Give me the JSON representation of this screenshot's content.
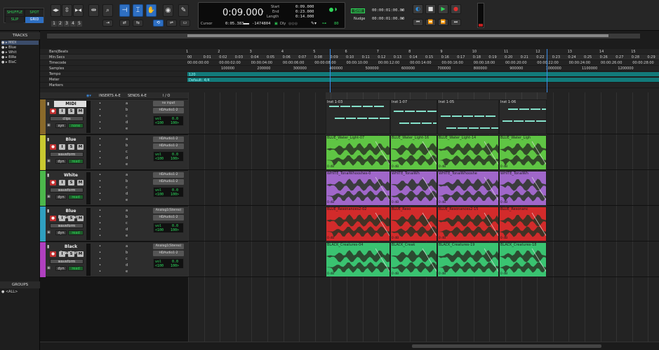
{
  "toolbar": {
    "modes": {
      "shuffle": "SHUFFLE",
      "spot": "SPOT",
      "slip": "SLIP",
      "grid": "GRID"
    },
    "zoom_presets": [
      "1",
      "2",
      "3",
      "4",
      "5"
    ],
    "main_counter": "0:09.000",
    "start_label": "Start",
    "end_label": "End",
    "length_label": "Length",
    "start": "0:09.000",
    "end": "0:23.000",
    "length": "0:14.000",
    "cursor_label": "Cursor",
    "cursor": "0:05.383",
    "sample": "-1474804",
    "dly_label": "Dly",
    "value80": "80",
    "grid_label": "Grid",
    "nudge_label": "Nudge",
    "grid_value": "00:00:01:00.00",
    "nudge_value": "00:00:01:00.00"
  },
  "left": {
    "tracks_header": "TRACKS",
    "track_list": [
      "MIDI",
      "Blue",
      "Whit",
      "BIRe",
      "BlaC"
    ],
    "groups_header": "GROUPS",
    "group_all": "<ALL>"
  },
  "rulers": {
    "rows": [
      "Bars|Beats",
      "Min:Secs",
      "Timecode",
      "Samples",
      "Tempo",
      "Meter",
      "Markers"
    ],
    "bar_ticks": [
      "1",
      "2",
      "3",
      "4",
      "5",
      "6",
      "7",
      "8",
      "9",
      "10",
      "11",
      "12",
      "13",
      "14",
      "15"
    ],
    "sec_ticks": [
      "00",
      "0:01",
      "0:02",
      "0:03",
      "0:04",
      "0:05",
      "0:06",
      "0:07",
      "0:08",
      "0:09",
      "0:10",
      "0:11",
      "0:12",
      "0:13",
      "0:14",
      "0:15",
      "0:16",
      "0:17",
      "0:18",
      "0:19",
      "0:20",
      "0:21",
      "0:22",
      "0:23",
      "0:24",
      "0:25",
      "0:26",
      "0:27",
      "0:28",
      "0:29"
    ],
    "timecode_ticks": [
      "00:00:00:00",
      "00:00:02:00",
      "00:00:04:00",
      "00:00:06:00",
      "00:00:08:00",
      "00:00:10:00",
      "00:00:12:00",
      "00:00:14:00",
      "00:00:16:00",
      "00:00:18:00",
      "00:00:20:00",
      "00:00:22:00",
      "00:00:24:00",
      "00:00:26:00",
      "00:00:28:00"
    ],
    "sample_ticks": [
      "100000",
      "200000",
      "300000",
      "400000",
      "500000",
      "600000",
      "700000",
      "800000",
      "900000",
      "1000000",
      "1100000",
      "1200000"
    ],
    "tempo": "120",
    "meter": "Default: 4/4"
  },
  "columns": {
    "inserts": "INSERTS A-E",
    "sends": "SENDS A-E",
    "io": "I / O"
  },
  "tracks": [
    {
      "name": "MIDI",
      "view": "clips",
      "mode": "none",
      "input": "no input",
      "output": "HDAudio1-2",
      "vol": "0.0",
      "pan_l": "<100",
      "pan_r": "100>",
      "inserts": [
        "•",
        "•",
        "•",
        "•",
        "•"
      ],
      "sends": [
        "a",
        "b",
        "c",
        "d",
        "e"
      ],
      "color": "#8a6a2a"
    },
    {
      "name": "Blue",
      "view": "waveform",
      "mode": "read",
      "input": "HDAudio1-2",
      "output": "HDAudio1-2",
      "vol": "0.0",
      "pan_l": "<100",
      "pan_r": "100>",
      "inserts": [
        "•",
        "•",
        "•",
        "•",
        "•"
      ],
      "sends": [
        "a",
        "b",
        "c",
        "d",
        "e"
      ],
      "color": "#c8c830"
    },
    {
      "name": "White",
      "view": "waveform",
      "mode": "read",
      "input": "HDAudio1-2",
      "output": "HDAudio1-2",
      "vol": "0.0",
      "pan_l": "<100",
      "pan_r": "100>",
      "inserts": [
        "•",
        "•",
        "•",
        "•",
        "•"
      ],
      "sends": [
        "a",
        "b",
        "c",
        "d",
        "e"
      ],
      "color": "#4cb84c"
    },
    {
      "name": "Blue Resonance",
      "view": "waveform",
      "mode": "read",
      "input": "Analog1(Stereo)",
      "output": "HDAudio1-2",
      "vol": "0.0",
      "pan_l": "<100",
      "pan_r": "100>",
      "inserts": [
        "•",
        "•",
        "•",
        "•",
        "•"
      ],
      "sends": [
        "a",
        "b",
        "c",
        "d",
        "e"
      ],
      "color": "#2fa0c0"
    },
    {
      "name": "Black Creatures",
      "view": "waveform",
      "mode": "read",
      "input": "Analog1(Stereo)",
      "output": "HDAudio1-2",
      "vol": "0.0",
      "pan_l": "<100",
      "pan_r": "100>",
      "inserts": [
        "•",
        "•",
        "•",
        "•",
        "•"
      ],
      "sends": [
        "a",
        "b",
        "c",
        "d",
        "e"
      ],
      "color": "#b040c0"
    }
  ],
  "clips": [
    {
      "color": "#1f1f1f",
      "items": [
        "Inst 1-03",
        "Inst 1-07",
        "Inst 1-05",
        "Inst 1-06"
      ]
    },
    {
      "color": "#57c23a",
      "items": [
        "BLUE_Water_Light-07",
        "BLUE_Water_Light-16",
        "BLUE_Water_Light-14",
        "BLUE_Water_Ligh"
      ]
    },
    {
      "color": "#9b5fc8",
      "items": [
        "WHITE_TonalWhooshes-0",
        "WHITE_TonalWh",
        "WHITE_TonalWhooshe",
        "WHITE_TonalWh"
      ]
    },
    {
      "color": "#d02020",
      "items": [
        "BLUE_Resonances2-02",
        "BLUE_Reso",
        "BLUE_Resonances2-15",
        "BLUE_Resonanc"
      ]
    },
    {
      "color": "#30c06a",
      "items": [
        "BLACK_Creatures-04",
        "BLACK_Creak",
        "BLACK_Creatures-19",
        "BLACK_Creatures-18"
      ]
    }
  ],
  "clip_gain": "0 dB",
  "colors": {
    "accent": "#2e6fc2",
    "selection": "#3a3a3a",
    "counter": "#e6e6e6"
  }
}
